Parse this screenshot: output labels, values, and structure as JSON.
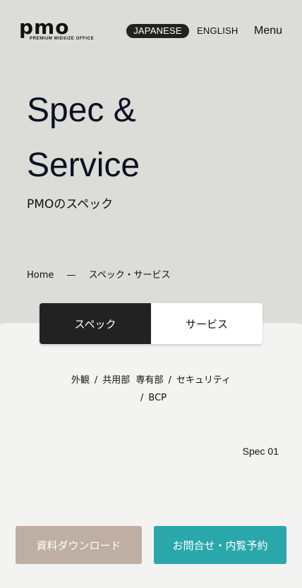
{
  "header": {
    "logo_text": "pmo",
    "logo_tagline": "PREMIUM MIDSIZE OFFICE",
    "lang_japanese": "JAPANESE",
    "lang_english": "ENGLISH",
    "menu_label": "Menu"
  },
  "hero": {
    "title_line1": "Spec &",
    "title_line2": "Service",
    "subtitle": "PMOのスペック"
  },
  "breadcrumb": {
    "home": "Home",
    "separator": "—",
    "current": "スペック・サービス"
  },
  "tabs": [
    {
      "label": "スペック",
      "active": true
    },
    {
      "label": "サービス",
      "active": false
    }
  ],
  "spec_links": {
    "items": [
      "外観",
      "共用部",
      "専有部",
      "セキュリティ",
      "BCP"
    ],
    "separator": "/"
  },
  "spec_section_label": "Spec 01",
  "buttons": {
    "download": "資料ダウンロード",
    "contact": "お問合せ・内覧予約"
  },
  "colors": {
    "hero_bg": "#dcdcd8",
    "panel_bg": "#f3f3f1",
    "active_tab": "#222222",
    "download_btn": "#bfaea3",
    "contact_btn": "#2aa7ab"
  }
}
